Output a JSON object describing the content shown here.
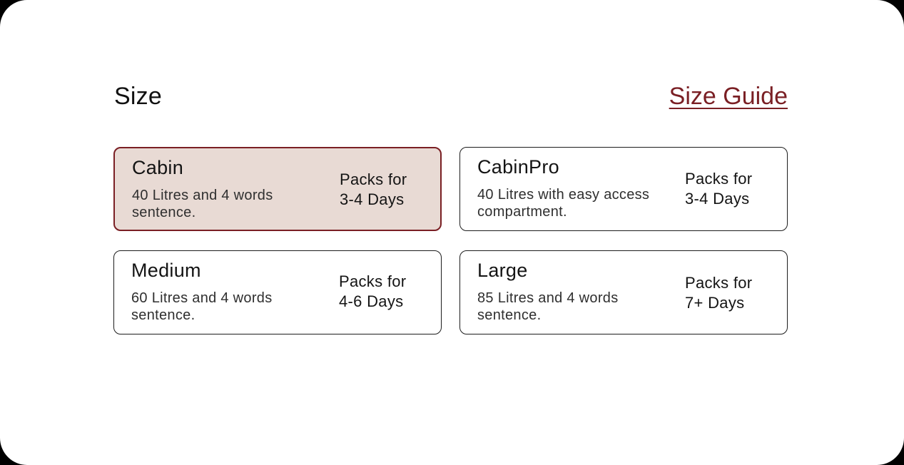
{
  "header": {
    "title": "Size",
    "guide_link": "Size Guide"
  },
  "options": [
    {
      "name": "Cabin",
      "description": "40 Litres and 4 words sentence.",
      "packs_line1": "Packs for",
      "packs_line2": "3-4 Days",
      "selected": true
    },
    {
      "name": "CabinPro",
      "description": "40 Litres with easy access compartment.",
      "packs_line1": "Packs for",
      "packs_line2": "3-4 Days",
      "selected": false
    },
    {
      "name": "Medium",
      "description": "60 Litres and 4 words sentence.",
      "packs_line1": "Packs for",
      "packs_line2": "4-6 Days",
      "selected": false
    },
    {
      "name": "Large",
      "description": "85 Litres and 4 words sentence.",
      "packs_line1": "Packs for",
      "packs_line2": "7+ Days",
      "selected": false
    }
  ],
  "colors": {
    "accent": "#7a1f24",
    "selected_background": "#e8dad4",
    "border": "#1d1d1d",
    "text": "#141414"
  }
}
